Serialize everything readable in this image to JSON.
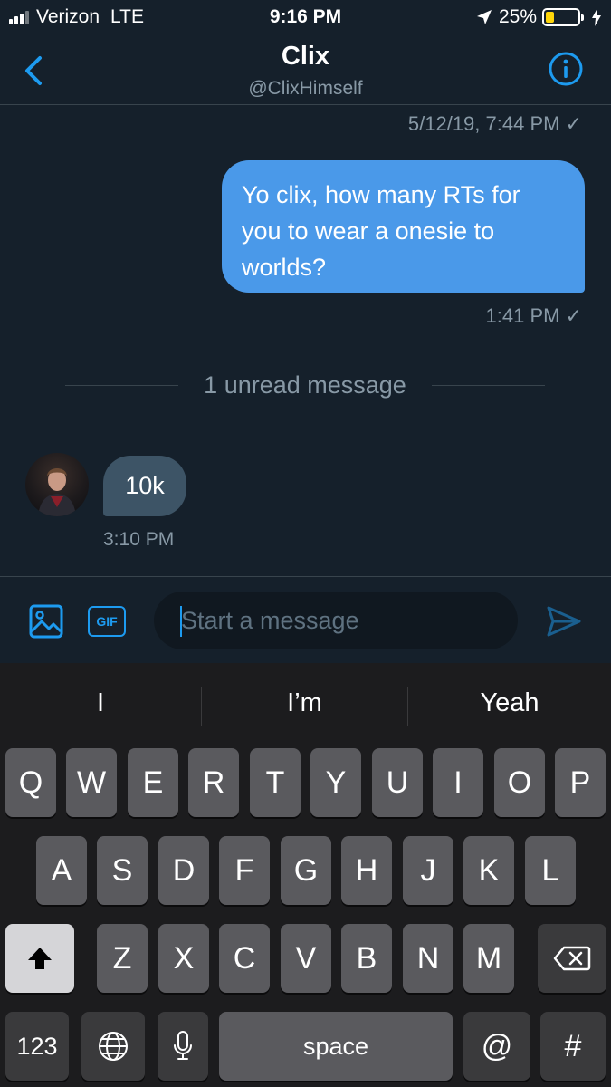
{
  "status_bar": {
    "carrier": "Verizon",
    "network": "LTE",
    "time": "9:16 PM",
    "battery": "25%",
    "battery_level": 0.25
  },
  "header": {
    "name": "Clix",
    "handle": "@ClixHimself"
  },
  "conversation": {
    "earlier_timestamp": "5/12/19, 7:44 PM ✓",
    "outgoing": {
      "text": "Yo clix, how many RTs for you to wear a onesie to worlds?",
      "timestamp": "1:41 PM ✓"
    },
    "unread_divider": "1 unread message",
    "incoming": {
      "text": "10k",
      "timestamp": "3:10 PM"
    }
  },
  "compose": {
    "placeholder": "Start a message",
    "gif_label": "GIF"
  },
  "keyboard": {
    "suggestions": [
      "I",
      "I’m",
      "Yeah"
    ],
    "row1": [
      "Q",
      "W",
      "E",
      "R",
      "T",
      "Y",
      "U",
      "I",
      "O",
      "P"
    ],
    "row2": [
      "A",
      "S",
      "D",
      "F",
      "G",
      "H",
      "J",
      "K",
      "L"
    ],
    "row3": [
      "Z",
      "X",
      "C",
      "V",
      "B",
      "N",
      "M"
    ],
    "numbers_label": "123",
    "space_label": "space",
    "at_label": "@",
    "hash_label": "#"
  },
  "colors": {
    "accent": "#1d9bf0",
    "outgoing_bubble": "#4a99e9",
    "incoming_bubble": "#3d5466",
    "background": "#15202b",
    "battery": "#ffd60a"
  }
}
